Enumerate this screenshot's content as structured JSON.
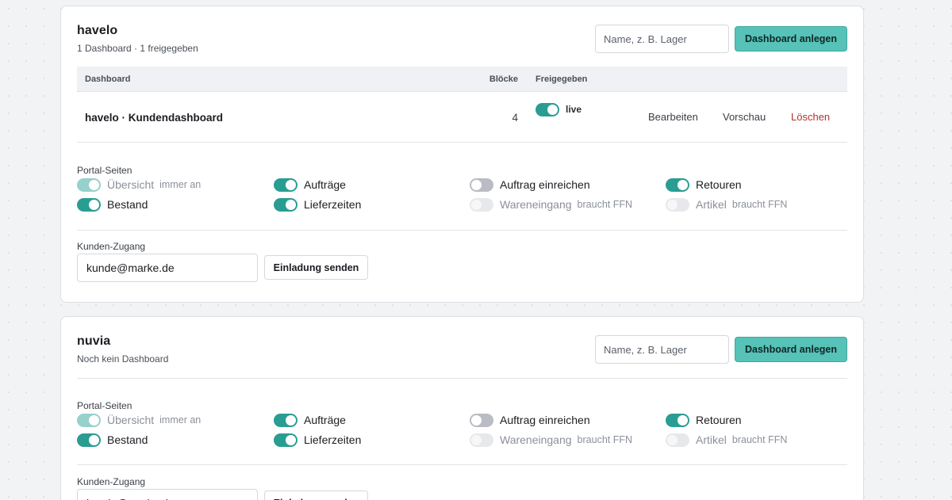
{
  "shared": {
    "name_placeholder": "Name, z. B. Lager",
    "create_button": "Dashboard anlegen",
    "portal_title": "Portal-Seiten",
    "access_title": "Kunden-Zugang",
    "email_value": "kunde@marke.de",
    "invite_button": "Einladung senden",
    "col_dashboard": "Dashboard",
    "col_blocks": "Blöcke",
    "col_shared": "Freigegeben",
    "page_uebersicht": "Übersicht",
    "note_always_on": "immer an",
    "page_auftraege": "Aufträge",
    "page_auftrag_einreichen": "Auftrag einreichen",
    "page_retouren": "Retouren",
    "page_bestand": "Bestand",
    "page_lieferzeiten": "Lieferzeiten",
    "page_wareneingang": "Wareneingang",
    "page_artikel": "Artikel",
    "note_needs_ffn": "braucht FFN"
  },
  "toggle_states": {
    "uebersicht": "locked-on",
    "auftraege": "on",
    "auftrag_einreichen": "off",
    "retouren": "on",
    "bestand": "on",
    "lieferzeiten": "on",
    "wareneingang": "disabled",
    "artikel": "disabled"
  },
  "card1": {
    "name": "havelo",
    "subtitle": "1 Dashboard · 1 freigegeben",
    "row": {
      "name": "havelo · Kundendashboard",
      "blocks": "4",
      "shared_on": true,
      "status": "live",
      "edit": "Bearbeiten",
      "preview": "Vorschau",
      "delete": "Löschen"
    }
  },
  "card2": {
    "name": "nuvia",
    "subtitle": "Noch kein Dashboard"
  },
  "colors": {
    "accent": "#56c2b8",
    "toggle_on": "#2a9d92",
    "danger": "#b23333"
  }
}
